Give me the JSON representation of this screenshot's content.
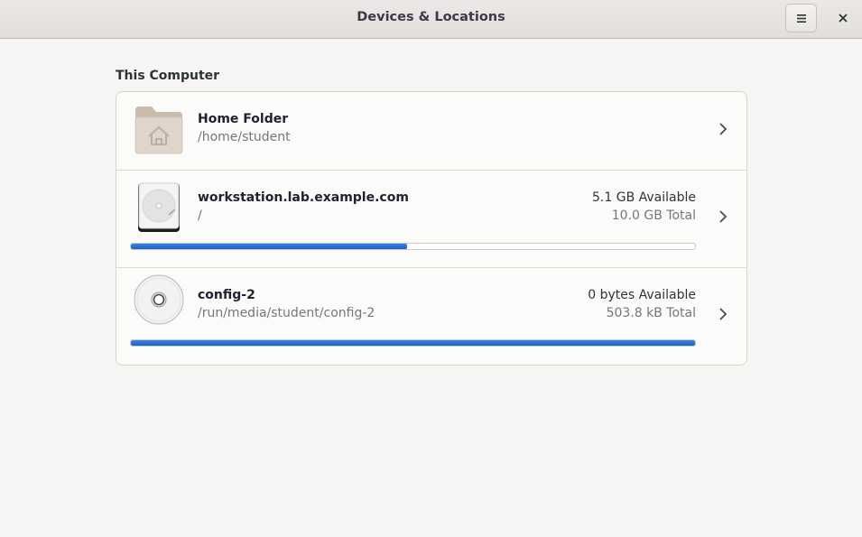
{
  "window": {
    "title": "Devices & Locations"
  },
  "icons": {
    "menu": "hamburger-menu-icon",
    "close": "close-icon",
    "chevron": "chevron-right-icon",
    "folder": "home-folder-icon",
    "drive": "hard-drive-icon",
    "optical": "optical-disc-icon"
  },
  "colors": {
    "accent": "#3584e4",
    "usage_bar": "#1c64c4"
  },
  "section": {
    "label": "This Computer"
  },
  "locations": [
    {
      "name": "Home Folder",
      "path": "/home/student"
    },
    {
      "name": "workstation.lab.example.com",
      "path": "/",
      "available": "5.1 GB Available",
      "total": "10.0 GB Total",
      "used_fraction": 0.49
    },
    {
      "name": "config-2",
      "path": "/run/media/student/config-2",
      "available": "0 bytes Available",
      "total": "503.8 kB Total",
      "used_fraction": 1.0
    }
  ]
}
